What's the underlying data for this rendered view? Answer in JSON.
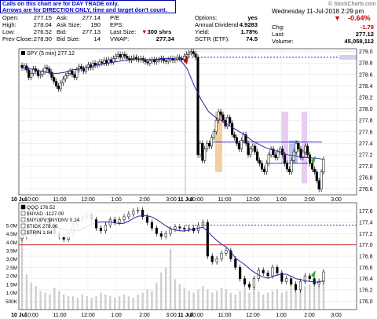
{
  "header": {
    "note_line1": "Calls on this chart are for DAY TRADE only.",
    "note_line2": "Arrows are for DIRECTION ONLY, time and target don't count.",
    "brand": "© StockCharts.com",
    "date_time": "Wednesday 11-Jul-2018 2:29 pm",
    "change_pct": "-0.64%",
    "quote": {
      "open_label": "Open:",
      "open": "277.15",
      "high_label": "High:",
      "high": "278.04",
      "low_label": "Low:",
      "low": "276.52",
      "prev_label": "Prev Close:",
      "prev": "278.90",
      "ask_label": "Ask:",
      "ask": "277.14",
      "asksize_label": "Ask Size:",
      "asksize": "190",
      "bid_label": "Bid:",
      "bid": "277.13",
      "bidsize_label": "Bid Size:",
      "bidsize": "14",
      "pe_label": "P/E",
      "pe": "",
      "eps_label": "EPS:",
      "eps": "",
      "lastsize_label": "Last Size:",
      "lastsize": "300 shrs",
      "vwap_label": "VWAP:",
      "vwap": "277.34",
      "options_label": "Options:",
      "options": "yes",
      "div_label": "Annual Dividend",
      "div": "4.9283",
      "yield_label": "Yield:",
      "yield": "1.78%",
      "sctr_label": "SCTR (ETF):",
      "sctr": "74.5",
      "chg_label": "Chg:",
      "chg": "-1.78",
      "last_label": "Last:",
      "last": "277.12",
      "volume_label": "Volume:",
      "volume": "45,058,112"
    }
  },
  "chart_data": [
    {
      "type": "candlestick",
      "legend": "SPY (5 min) 277.12",
      "x_ticks": [
        "10 Jul",
        "10:00",
        "11:00",
        "12:00",
        "1:00",
        "2:00",
        "3:00",
        "11 Jul",
        "10:00",
        "11:00",
        "12:00",
        "1:00",
        "2:00",
        "3:00"
      ],
      "y_ticks": [
        "279.0",
        "278.8",
        "278.6",
        "278.4",
        "278.2",
        "278.0",
        "277.8",
        "277.6",
        "277.4",
        "277.2",
        "277.0",
        "276.8",
        "276.6"
      ],
      "ylim": [
        276.5,
        279.05
      ],
      "closes": [
        278.72,
        278.75,
        278.68,
        278.55,
        278.62,
        278.7,
        278.66,
        278.58,
        278.6,
        278.65,
        278.72,
        278.7,
        278.64,
        278.55,
        278.48,
        278.4,
        278.35,
        278.45,
        278.52,
        278.58,
        278.62,
        278.66,
        278.6,
        278.55,
        278.68,
        278.74,
        278.7,
        278.66,
        278.72,
        278.77,
        278.72,
        278.8,
        278.76,
        278.78,
        278.82,
        278.8,
        278.85,
        278.8,
        278.86,
        278.82,
        278.88,
        278.92,
        278.95,
        278.9,
        278.95,
        278.92,
        278.88,
        278.85,
        278.88,
        278.9,
        278.87,
        278.86,
        278.88,
        278.85,
        278.82,
        278.8,
        278.84,
        278.86,
        278.82,
        278.85,
        278.86,
        278.88,
        278.84,
        278.83,
        278.86,
        278.88,
        278.85,
        278.87,
        278.9,
        278.88,
        278.86,
        278.92,
        278.95,
        278.98,
        279.0,
        278.96,
        278.9,
        277.2,
        277.4,
        277.1,
        277.3,
        277.4,
        277.35,
        277.5,
        277.6,
        277.8,
        277.95,
        277.9,
        277.8,
        277.7,
        277.85,
        277.75,
        277.55,
        277.5,
        277.4,
        277.3,
        277.45,
        277.55,
        277.4,
        277.2,
        277.3,
        277.35,
        277.25,
        277.1,
        277.05,
        276.95,
        276.9,
        277.05,
        277.2,
        277.3,
        277.2,
        277.15,
        277.25,
        277.3,
        277.2,
        277.05,
        276.95,
        276.9,
        277.1,
        277.25,
        277.4,
        277.3,
        277.15,
        277.25,
        277.35,
        277.2,
        277.05,
        276.95,
        276.9,
        276.75,
        276.6,
        276.9,
        277.12
      ],
      "vwap_line": [
        278.72,
        278.7,
        278.68,
        278.65,
        278.62,
        278.62,
        278.64,
        278.68,
        278.7,
        278.72,
        278.75,
        278.78,
        278.8,
        278.82,
        278.84,
        278.86,
        278.87,
        278.86,
        278.86,
        278.87,
        278.88,
        278.88,
        278.86,
        278.7,
        278.4,
        278.15,
        277.95,
        277.85,
        277.78,
        277.7,
        277.62,
        277.55,
        277.45,
        277.38,
        277.32,
        277.28,
        277.25,
        277.2,
        277.18,
        277.16,
        277.15,
        277.14,
        277.12
      ],
      "levels": [
        {
          "price": 278.9,
          "style": "dashed",
          "color": "#0000cc"
        },
        {
          "price": 277.42,
          "style": "solid",
          "color": "#0000cc"
        },
        {
          "price": 277.05,
          "style": "solid",
          "color": "#0000cc"
        }
      ]
    },
    {
      "type": "line",
      "legend": [
        "QQQ 176.52",
        "$NYAD -1127.00",
        "$NYUPV:$NYDNV 0.24",
        "$TICK 278.00",
        "$TRIN 1.84"
      ],
      "right_ticks": [
        "177.6",
        "177.4",
        "177.2",
        "177.0",
        "176.8",
        "176.6",
        "176.4",
        "176.2",
        "176.0"
      ],
      "left_ticks": [
        "5.0M",
        "4.5M",
        "4.0M",
        "3.5M",
        "3.0M",
        "2.5M",
        "2.0M",
        "1.5M",
        "1.0M",
        "500K"
      ],
      "x_ticks": [
        "10 Jul",
        "10:00",
        "11:00",
        "12:00",
        "1:00",
        "2:00",
        "3:00",
        "11 Jul",
        "10:00",
        "11:00",
        "12:00",
        "1:00",
        "2:00",
        "3:00"
      ],
      "ylim": [
        175.85,
        177.75
      ],
      "closes": [
        177.15,
        177.25,
        177.2,
        177.35,
        177.4,
        177.45,
        177.35,
        177.2,
        177.15,
        177.1,
        177.2,
        177.35,
        177.45,
        177.5,
        177.55,
        177.45,
        177.3,
        177.25,
        177.35,
        177.45,
        177.4,
        177.45,
        177.5,
        177.55,
        177.6,
        177.62,
        177.5,
        177.4,
        177.3,
        177.2,
        177.15,
        177.2,
        177.28,
        177.32,
        177.3,
        177.28,
        177.3,
        177.25,
        177.35,
        177.4,
        176.8,
        176.7,
        176.75,
        176.85,
        176.9,
        176.75,
        176.6,
        176.4,
        176.3,
        176.25,
        176.4,
        176.55,
        176.5,
        176.45,
        176.6,
        176.5,
        176.35,
        176.4,
        176.3,
        176.2,
        176.35,
        176.45,
        176.4,
        176.3,
        176.35,
        176.52
      ],
      "volume": [
        4.2,
        2.1,
        1.6,
        1.4,
        1.1,
        1.0,
        0.9,
        1.3,
        1.1,
        0.9,
        0.8,
        0.8,
        0.7,
        0.9,
        0.8,
        0.7,
        0.8,
        1.0,
        0.9,
        0.8,
        0.7,
        0.8,
        0.9,
        0.8,
        0.7,
        0.9,
        1.0,
        1.2,
        1.1,
        1.6,
        2.2,
        2.5,
        3.6,
        1.8,
        1.5,
        1.3,
        1.1,
        1.0,
        1.2,
        1.4,
        1.2,
        1.0,
        1.1,
        1.3,
        1.2,
        1.0,
        0.9,
        1.1,
        1.3,
        1.0,
        1.2,
        1.1,
        0.9,
        1.0,
        1.1,
        1.2,
        1.0,
        1.1,
        1.3,
        1.0,
        1.2,
        1.4,
        1.5,
        1.3,
        1.4,
        1.6
      ],
      "levels": [
        {
          "price": 177.35,
          "style": "dashed",
          "color": "#0000cc"
        },
        {
          "price": 177.0,
          "style": "solid",
          "color": "#cc0000"
        }
      ]
    }
  ],
  "colors": {
    "up": "#000000",
    "down": "#000000",
    "upfill": "#ffffff",
    "wma": "#2222aa",
    "orange": "#f4c48a",
    "violet": "#e6c6f2",
    "bluebox": "#b5b9ee",
    "red_marker": "#cc0000",
    "green_marker": "#33aa33"
  }
}
